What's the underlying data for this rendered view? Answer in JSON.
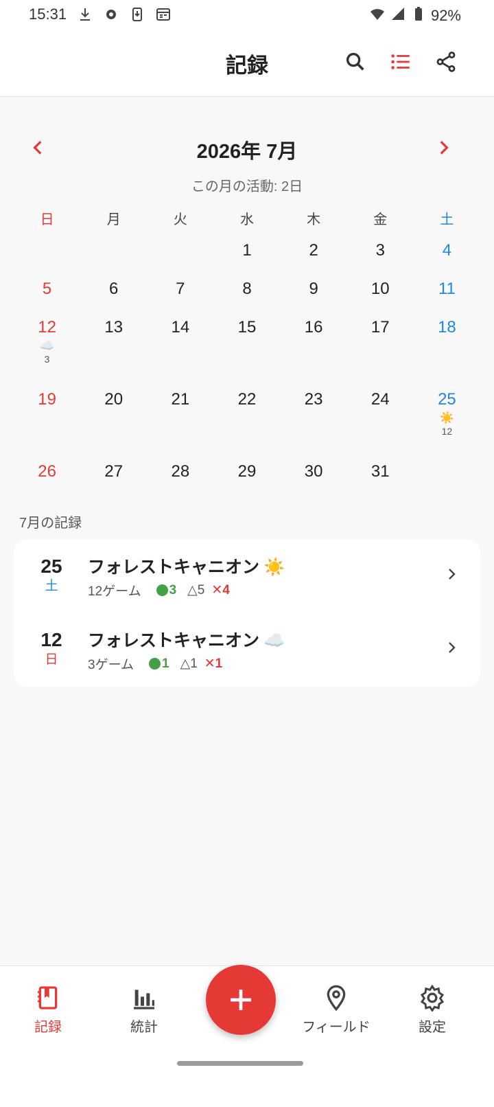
{
  "status_bar": {
    "time": "15:31",
    "battery": "92%"
  },
  "app_bar": {
    "title": "記録"
  },
  "calendar": {
    "month_label": "2026年 7月",
    "activity_text": "この月の活動: 2日",
    "weekdays": [
      "日",
      "月",
      "火",
      "水",
      "木",
      "金",
      "土"
    ],
    "weeks": [
      [
        {
          "d": ""
        },
        {
          "d": ""
        },
        {
          "d": ""
        },
        {
          "d": "1"
        },
        {
          "d": "2"
        },
        {
          "d": "3"
        },
        {
          "d": "4"
        }
      ],
      [
        {
          "d": "5"
        },
        {
          "d": "6"
        },
        {
          "d": "7"
        },
        {
          "d": "8"
        },
        {
          "d": "9"
        },
        {
          "d": "10"
        },
        {
          "d": "11"
        }
      ],
      [
        {
          "d": "12",
          "icon": "☁️",
          "count": "3"
        },
        {
          "d": "13"
        },
        {
          "d": "14"
        },
        {
          "d": "15"
        },
        {
          "d": "16"
        },
        {
          "d": "17"
        },
        {
          "d": "18"
        }
      ],
      [
        {
          "d": "19"
        },
        {
          "d": "20"
        },
        {
          "d": "21"
        },
        {
          "d": "22"
        },
        {
          "d": "23"
        },
        {
          "d": "24"
        },
        {
          "d": "25",
          "icon": "☀️",
          "count": "12"
        }
      ],
      [
        {
          "d": "26"
        },
        {
          "d": "27"
        },
        {
          "d": "28"
        },
        {
          "d": "29"
        },
        {
          "d": "30"
        },
        {
          "d": "31"
        },
        {
          "d": ""
        }
      ]
    ]
  },
  "records_section": {
    "label": "7月の記録",
    "items": [
      {
        "day": "25",
        "weekday": "土",
        "field": "フォレストキャニオン",
        "weather": "☀️",
        "games": "12ゲーム",
        "wins": "3",
        "draws": "△5",
        "losses": "✕4"
      },
      {
        "day": "12",
        "weekday": "日",
        "field": "フォレストキャニオン",
        "weather": "☁️",
        "games": "3ゲーム",
        "wins": "1",
        "draws": "△1",
        "losses": "✕1"
      }
    ]
  },
  "bottom_nav": {
    "items": [
      {
        "label": "記録",
        "icon": "book-icon"
      },
      {
        "label": "統計",
        "icon": "bar-chart-icon"
      },
      {
        "label": "フィールド",
        "icon": "location-pin-icon"
      },
      {
        "label": "設定",
        "icon": "gear-icon"
      }
    ],
    "fab_icon": "plus-icon"
  },
  "colors": {
    "accent": "#e53935",
    "sunday": "#e53935",
    "saturday": "#1e88e5",
    "win": "#43a047"
  }
}
